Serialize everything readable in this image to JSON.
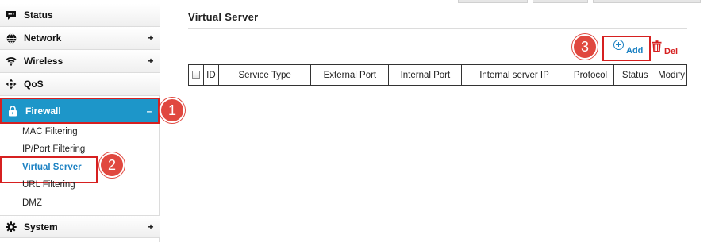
{
  "sidebar": {
    "items": [
      {
        "label": "Status",
        "icon": "chat-bubble-icon",
        "sign": ""
      },
      {
        "label": "Network",
        "icon": "globe-icon",
        "sign": "+"
      },
      {
        "label": "Wireless",
        "icon": "wifi-icon",
        "sign": "+"
      },
      {
        "label": "QoS",
        "icon": "qos-arrows-icon",
        "sign": ""
      },
      {
        "label": "Firewall",
        "icon": "lock-icon",
        "sign": "–"
      },
      {
        "label": "System",
        "icon": "gear-icon",
        "sign": "+"
      }
    ],
    "firewall_sub": [
      {
        "label": "MAC Filtering"
      },
      {
        "label": "IP/Port Filtering"
      },
      {
        "label": "Virtual Server"
      },
      {
        "label": "URL Filtering"
      },
      {
        "label": "DMZ"
      }
    ]
  },
  "main": {
    "title": "Virtual Server",
    "add_label": "Add",
    "del_label": "Del",
    "table": {
      "headers": [
        "",
        "ID",
        "Service Type",
        "External Port",
        "Internal Port",
        "Internal server IP",
        "Protocol",
        "Status",
        "Modify"
      ]
    }
  },
  "callouts": [
    "1",
    "2",
    "3"
  ],
  "colors": {
    "active_bg": "#1d96c9",
    "highlight_border": "#d62020",
    "callout": "#e0483f",
    "link_blue": "#1d82c3",
    "delete_red": "#d62020"
  }
}
